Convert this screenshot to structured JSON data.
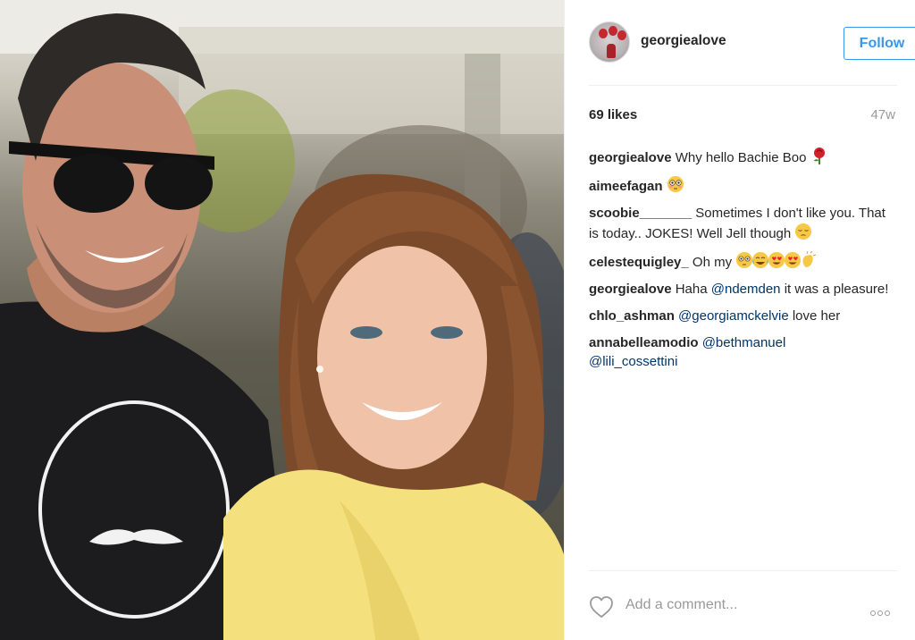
{
  "post": {
    "username": "georgiealove",
    "follow_label": "Follow",
    "likes": "69 likes",
    "age": "47w",
    "add_comment_placeholder": "Add a comment...",
    "comments": [
      {
        "user": "georgiealove",
        "text": "Why hello Bachie Boo",
        "emoji": [
          "rose"
        ]
      },
      {
        "user": "aimeefagan",
        "text": "",
        "emoji": [
          "flushed"
        ]
      },
      {
        "user": "scoobie_______",
        "text": "Sometimes I don't like you. That is today.. JOKES! Well Jell though",
        "emoji": [
          "pensive"
        ]
      },
      {
        "user": "celestequigley_",
        "text": "Oh my",
        "emoji": [
          "flushed",
          "joy-tears",
          "heart-eyes",
          "heart-eyes",
          "clap"
        ]
      },
      {
        "user": "georgiealove",
        "text_pre": "Haha",
        "mention": "@ndemden",
        "text_post": "it was a pleasure!"
      },
      {
        "user": "chlo_ashman",
        "mention": "@georgiamckelvie",
        "text_post": "love her"
      },
      {
        "user": "annabelleamodio",
        "mention": "@bethmanuel",
        "mention2": "@lili_cossettini"
      }
    ]
  },
  "colors": {
    "accent": "#3897f0",
    "mention": "#003569",
    "muted": "#999999",
    "text": "#262626"
  }
}
